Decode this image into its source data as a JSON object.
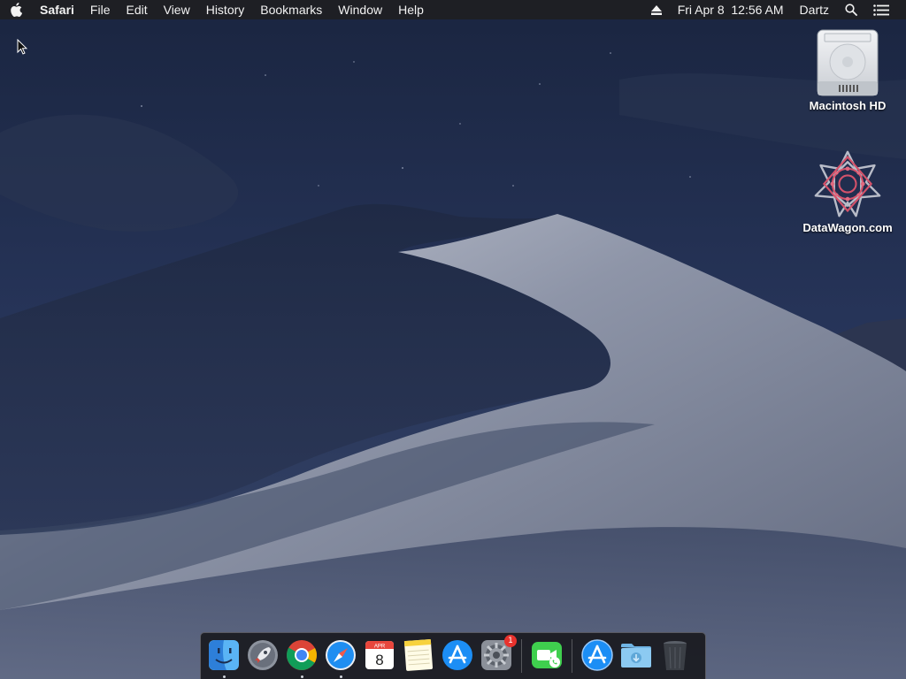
{
  "menubar": {
    "app_name": "Safari",
    "menus": [
      "File",
      "Edit",
      "View",
      "History",
      "Bookmarks",
      "Window",
      "Help"
    ],
    "status": {
      "datetime": "Fri Apr 8  12:56 AM",
      "user": "Dartz"
    }
  },
  "desktop_icons": [
    {
      "label": "Macintosh HD",
      "icon": "hard-drive-icon"
    },
    {
      "label": "DataWagon.com",
      "icon": "datawagon-logo-icon"
    }
  ],
  "dock": {
    "apps": [
      {
        "name": "Finder",
        "icon": "finder-icon",
        "running": true
      },
      {
        "name": "Launchpad",
        "icon": "launchpad-icon",
        "running": false
      },
      {
        "name": "Google Chrome",
        "icon": "chrome-icon",
        "running": true
      },
      {
        "name": "Safari",
        "icon": "safari-icon",
        "running": true
      },
      {
        "name": "Calendar",
        "icon": "calendar-icon",
        "running": false,
        "calendar_month": "APR",
        "calendar_day": "8"
      },
      {
        "name": "Notes",
        "icon": "notes-icon",
        "running": false
      },
      {
        "name": "App Store",
        "icon": "app-store-icon",
        "running": false
      },
      {
        "name": "System Preferences",
        "icon": "system-preferences-icon",
        "running": false,
        "badge": "1"
      },
      {
        "name": "FaceTime",
        "icon": "facetime-icon",
        "running": false
      }
    ],
    "stack": [
      {
        "name": "Applications",
        "icon": "applications-folder-icon"
      },
      {
        "name": "Downloads",
        "icon": "downloads-folder-icon"
      },
      {
        "name": "Trash",
        "icon": "trash-icon"
      }
    ]
  },
  "colors": {
    "menubar_bg": "#1e1e22",
    "dock_bg": "#141418",
    "badge": "#e8322d",
    "wallpaper_sky": "#1b2740",
    "wallpaper_dune": "#4c5670"
  }
}
